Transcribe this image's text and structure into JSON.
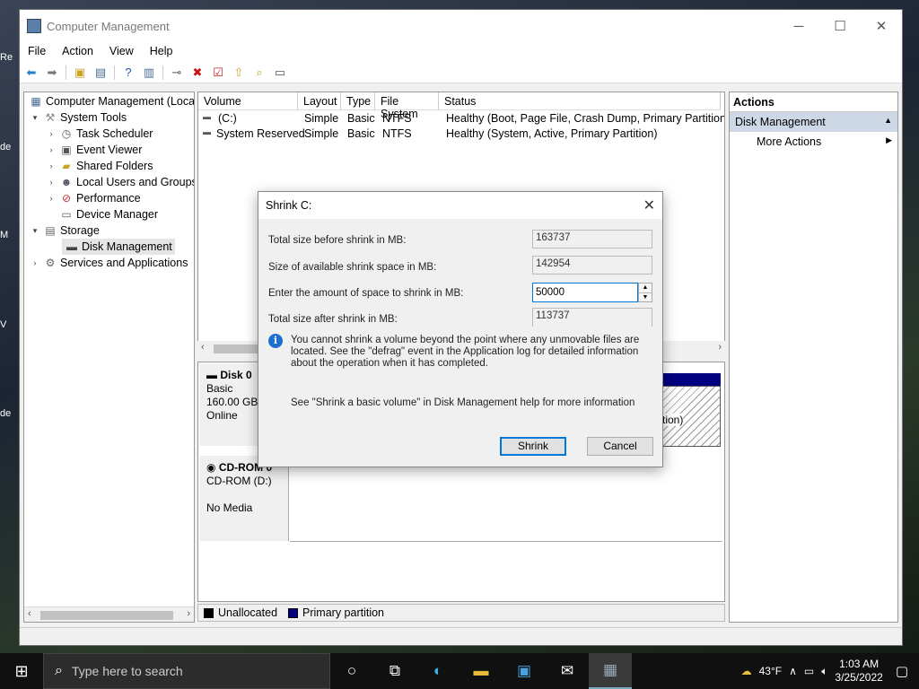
{
  "window": {
    "title": "Computer Management",
    "minimize": "─",
    "maximize": "☐",
    "close": "✕"
  },
  "menu": [
    "File",
    "Action",
    "View",
    "Help"
  ],
  "desktop_icons": [
    "Re",
    "de",
    "M",
    "V",
    "de"
  ],
  "tree": {
    "root": "Computer Management (Local",
    "system_tools": "System Tools",
    "task_scheduler": "Task Scheduler",
    "event_viewer": "Event Viewer",
    "shared_folders": "Shared Folders",
    "local_users": "Local Users and Groups",
    "performance": "Performance",
    "device_manager": "Device Manager",
    "storage": "Storage",
    "disk_management": "Disk Management",
    "services": "Services and Applications"
  },
  "volume_list": {
    "headers": [
      "Volume",
      "Layout",
      "Type",
      "File System",
      "Status"
    ],
    "rows": [
      [
        "(C:)",
        "Simple",
        "Basic",
        "NTFS",
        "Healthy (Boot, Page File, Crash Dump, Primary Partition)"
      ],
      [
        "System Reserved",
        "Simple",
        "Basic",
        "NTFS",
        "Healthy (System, Active, Primary Partition)"
      ]
    ]
  },
  "disks": {
    "disk0": {
      "name": "Disk 0",
      "type": "Basic",
      "size": "160.00 GB",
      "state": "Online",
      "partition_fragment": "tion)"
    },
    "cdrom0": {
      "name": "CD-ROM 0",
      "drive": "CD-ROM (D:)",
      "media": "No Media"
    }
  },
  "legend": {
    "unallocated": "Unallocated",
    "primary": "Primary partition"
  },
  "actions": {
    "title": "Actions",
    "section": "Disk Management",
    "more": "More Actions"
  },
  "dialog": {
    "title": "Shrink C:",
    "total_before_label": "Total size before shrink in MB:",
    "total_before_value": "163737",
    "available_label": "Size of available shrink space in MB:",
    "available_value": "142954",
    "amount_label": "Enter the amount of space to shrink in MB:",
    "amount_value": "50000",
    "total_after_label": "Total size after shrink in MB:",
    "total_after_value": "113737",
    "info": "You cannot shrink a volume beyond the point where any unmovable files are located. See the \"defrag\" event in the Application log for detailed information about the operation when it has completed.",
    "help": "See \"Shrink a basic volume\" in Disk Management help for more information",
    "shrink_label": "Shrink",
    "cancel_label": "Cancel"
  },
  "taskbar": {
    "search_placeholder": "Type here to search",
    "temperature": "43°F",
    "time": "1:03 AM",
    "date": "3/25/2022"
  },
  "colors": {
    "unallocated": "#000000",
    "primary_partition": "#000080",
    "accent": "#0078d7"
  }
}
